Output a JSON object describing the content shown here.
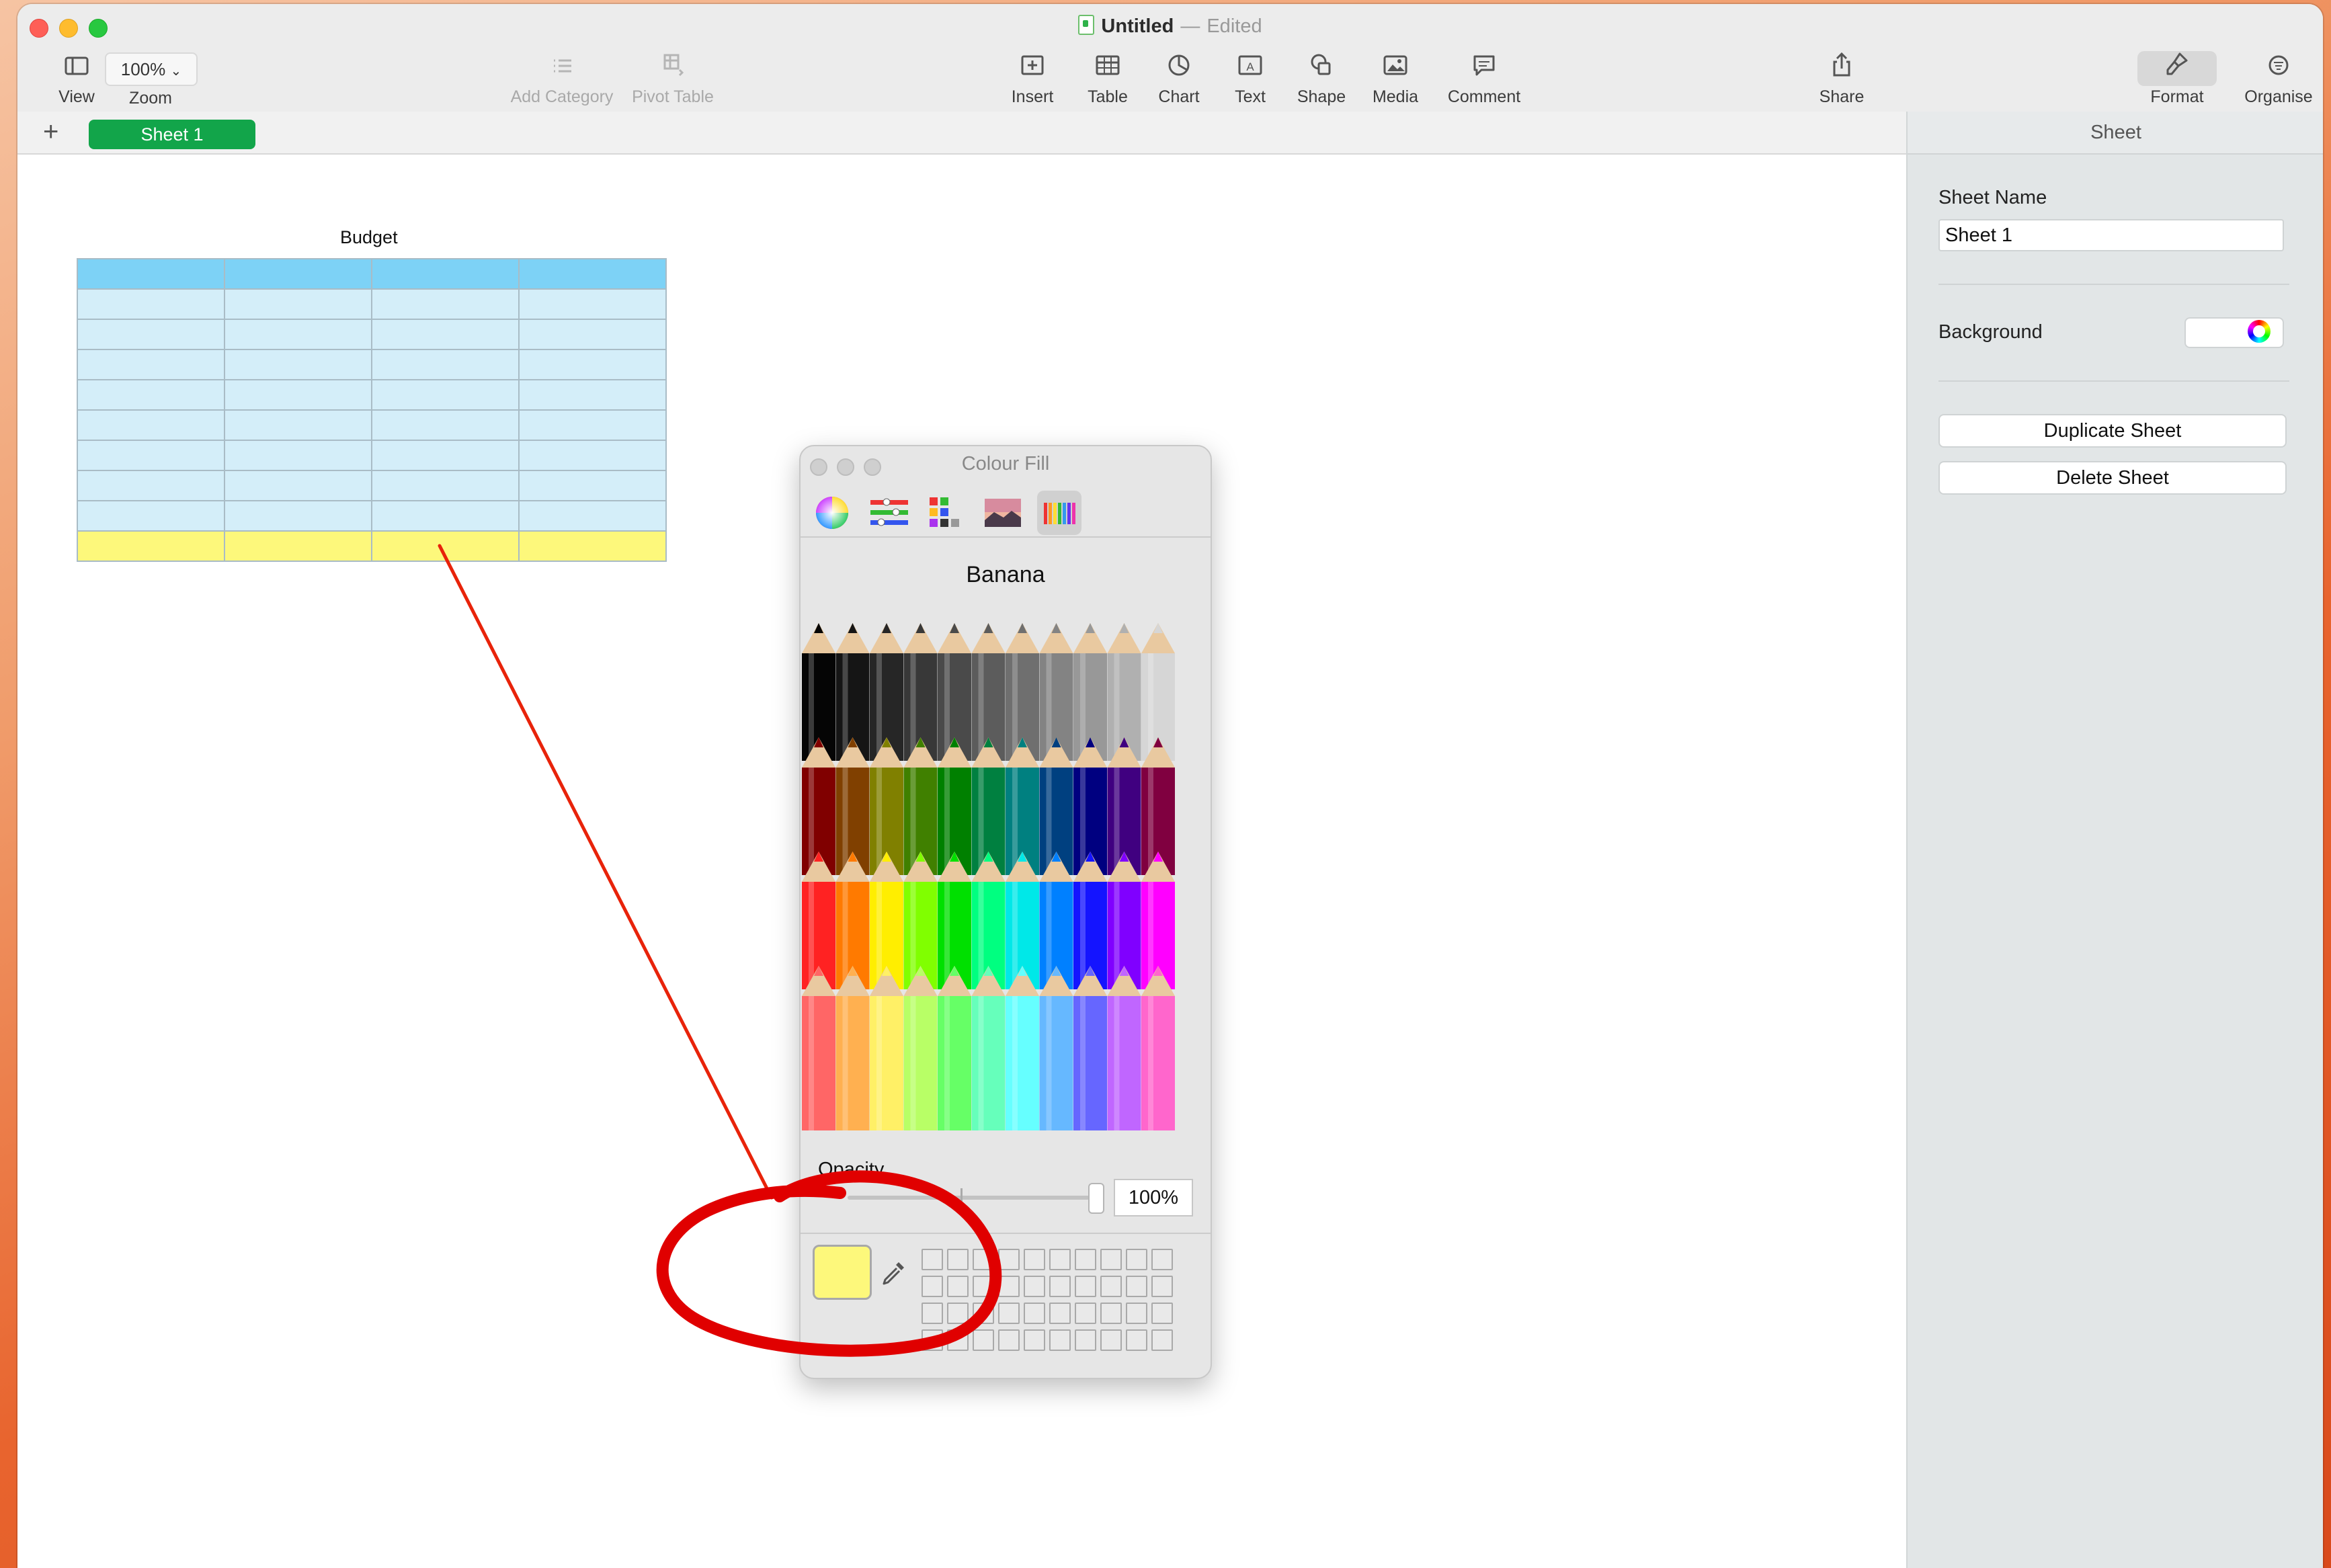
{
  "window": {
    "doc_title": "Untitled",
    "title_sep": "—",
    "status": "Edited"
  },
  "toolbar": {
    "view": "View",
    "zoom_value": "100%",
    "zoom": "Zoom",
    "add_category": "Add Category",
    "pivot_table": "Pivot Table",
    "insert": "Insert",
    "table": "Table",
    "chart": "Chart",
    "text": "Text",
    "shape": "Shape",
    "media": "Media",
    "comment": "Comment",
    "share": "Share",
    "format": "Format",
    "organise": "Organise"
  },
  "tabs": {
    "add": "+",
    "active": "Sheet 1"
  },
  "sidebar": {
    "header": "Sheet",
    "sheet_name_label": "Sheet Name",
    "sheet_name_value": "Sheet 1",
    "background_label": "Background",
    "duplicate": "Duplicate Sheet",
    "delete": "Delete Sheet",
    "background_color": "#ffffff"
  },
  "table": {
    "title": "Budget",
    "header_color": "#7dd2f6",
    "body_color": "#d4eef9",
    "footer_color": "#fdf87b"
  },
  "colour_panel": {
    "title": "Colour Fill",
    "selected_name": "Banana",
    "opacity_label": "Opacity",
    "opacity_value": "100%",
    "selected_color": "#fdf87b",
    "modes": [
      "colour-wheel-icon",
      "sliders-icon",
      "palettes-icon",
      "image-palette-icon",
      "pencils-icon"
    ]
  }
}
